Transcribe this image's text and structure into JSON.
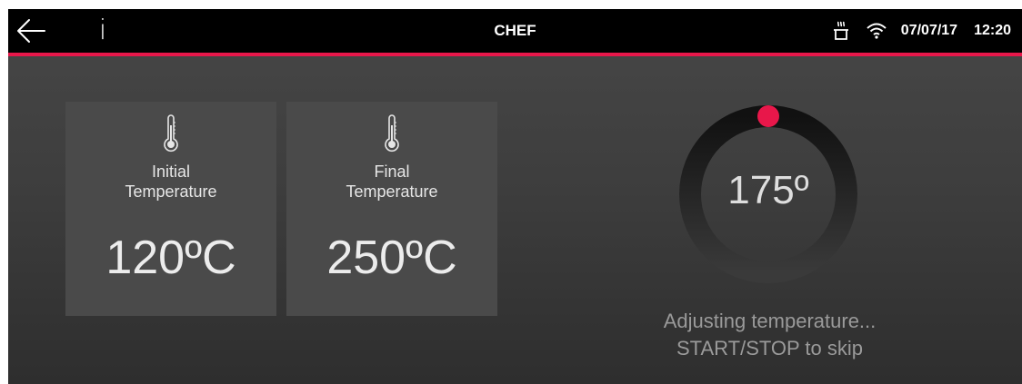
{
  "header": {
    "title": "CHEF",
    "info_label": "i",
    "date": "07/07/17",
    "time": "12:20",
    "icons": [
      "back-arrow-icon",
      "info-icon",
      "steam-icon",
      "wifi-icon"
    ]
  },
  "tiles": [
    {
      "label_line1": "Initial",
      "label_line2": "Temperature",
      "value": "120ºC",
      "icon": "thermometer-icon"
    },
    {
      "label_line1": "Final",
      "label_line2": "Temperature",
      "value": "250ºC",
      "icon": "thermometer-icon"
    }
  ],
  "dial": {
    "value": "175º"
  },
  "message": {
    "line1": "Adjusting temperature...",
    "line2": "START/STOP to skip"
  },
  "colors": {
    "accent": "#e8174a",
    "topbar": "#000000",
    "background": "#3e3e3e",
    "tile": "#4a4a4a"
  }
}
